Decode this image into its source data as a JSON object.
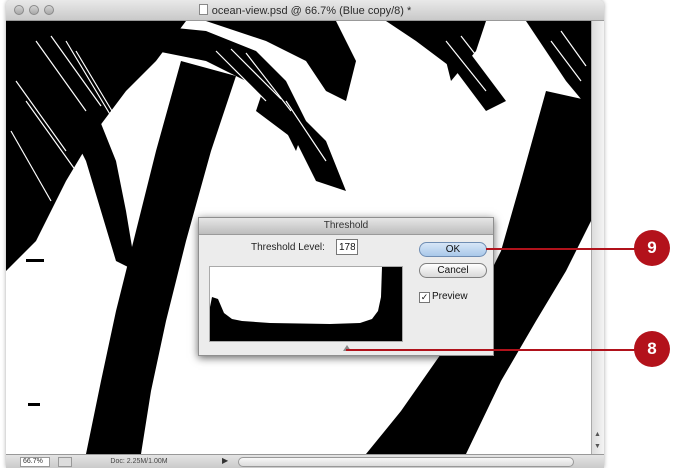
{
  "window": {
    "title": "ocean-view.psd @ 66.7% (Blue copy/8) *"
  },
  "status": {
    "zoom": "66.7%",
    "doc_info": "Doc: 2.25M/1.00M"
  },
  "dialog": {
    "title": "Threshold",
    "level_label": "Threshold Level:",
    "level_value": "178",
    "ok_label": "OK",
    "cancel_label": "Cancel",
    "preview_label": "Preview",
    "preview_checked": true
  },
  "callouts": [
    {
      "number": "9"
    },
    {
      "number": "8"
    }
  ],
  "colors": {
    "callout": "#b3121b",
    "ok_button": "#a9c8ea"
  }
}
